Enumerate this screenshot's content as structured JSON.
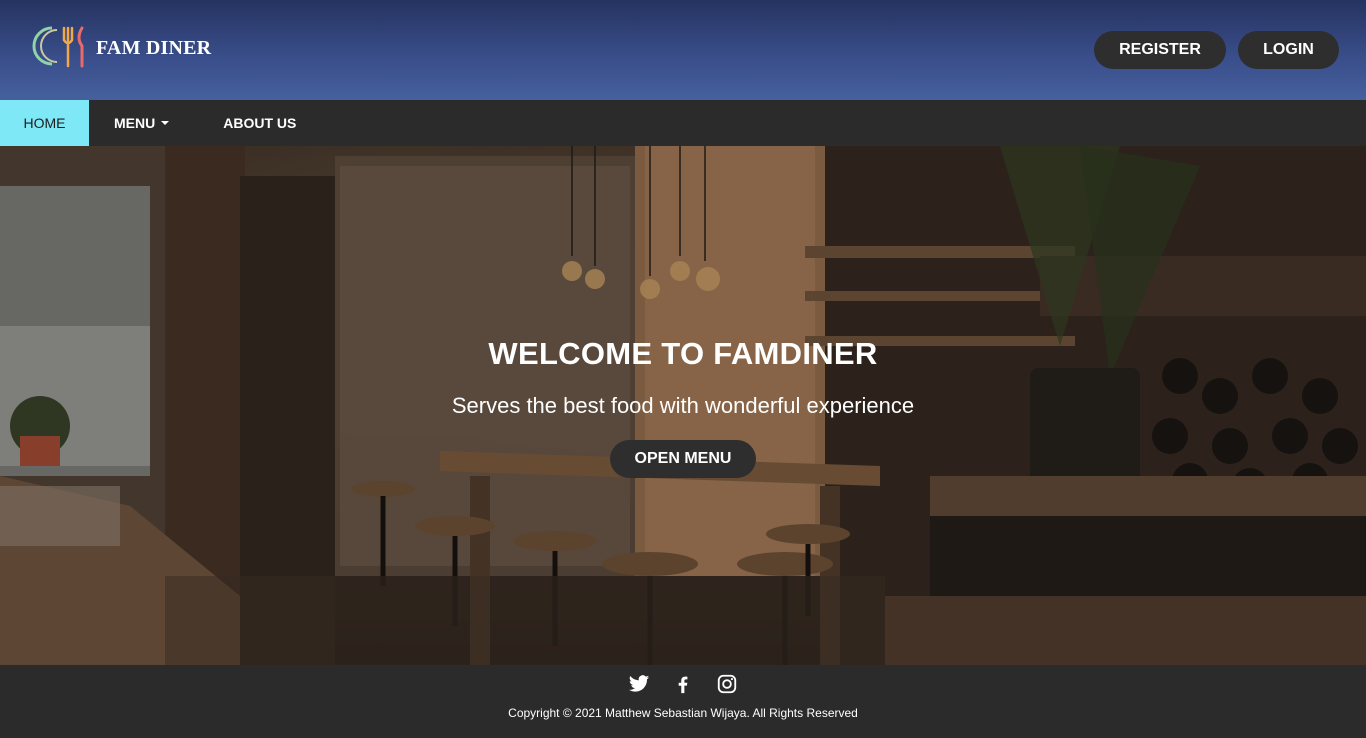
{
  "header": {
    "logo_text": "FAM DINER",
    "register_label": "REGISTER",
    "login_label": "LOGIN"
  },
  "nav": {
    "items": [
      {
        "label": "HOME",
        "active": true
      },
      {
        "label": "MENU",
        "has_dropdown": true
      },
      {
        "label": "ABOUT US"
      }
    ]
  },
  "hero": {
    "title": "WELCOME TO FAMDINER",
    "subtitle": "Serves the best food with wonderful experience",
    "cta_label": "OPEN MENU"
  },
  "footer": {
    "socials": [
      "twitter-icon",
      "facebook-icon",
      "instagram-icon"
    ],
    "copyright": "Copyright © 2021 Matthew Sebastian Wijaya. All Rights Reserved"
  },
  "colors": {
    "header_top": "#253360",
    "header_bottom": "#46609e",
    "nav_bg": "#2b2b2b",
    "nav_active": "#7ee8f7",
    "button_bg": "#2e2e2e",
    "footer_bg": "#2b2b2b"
  }
}
